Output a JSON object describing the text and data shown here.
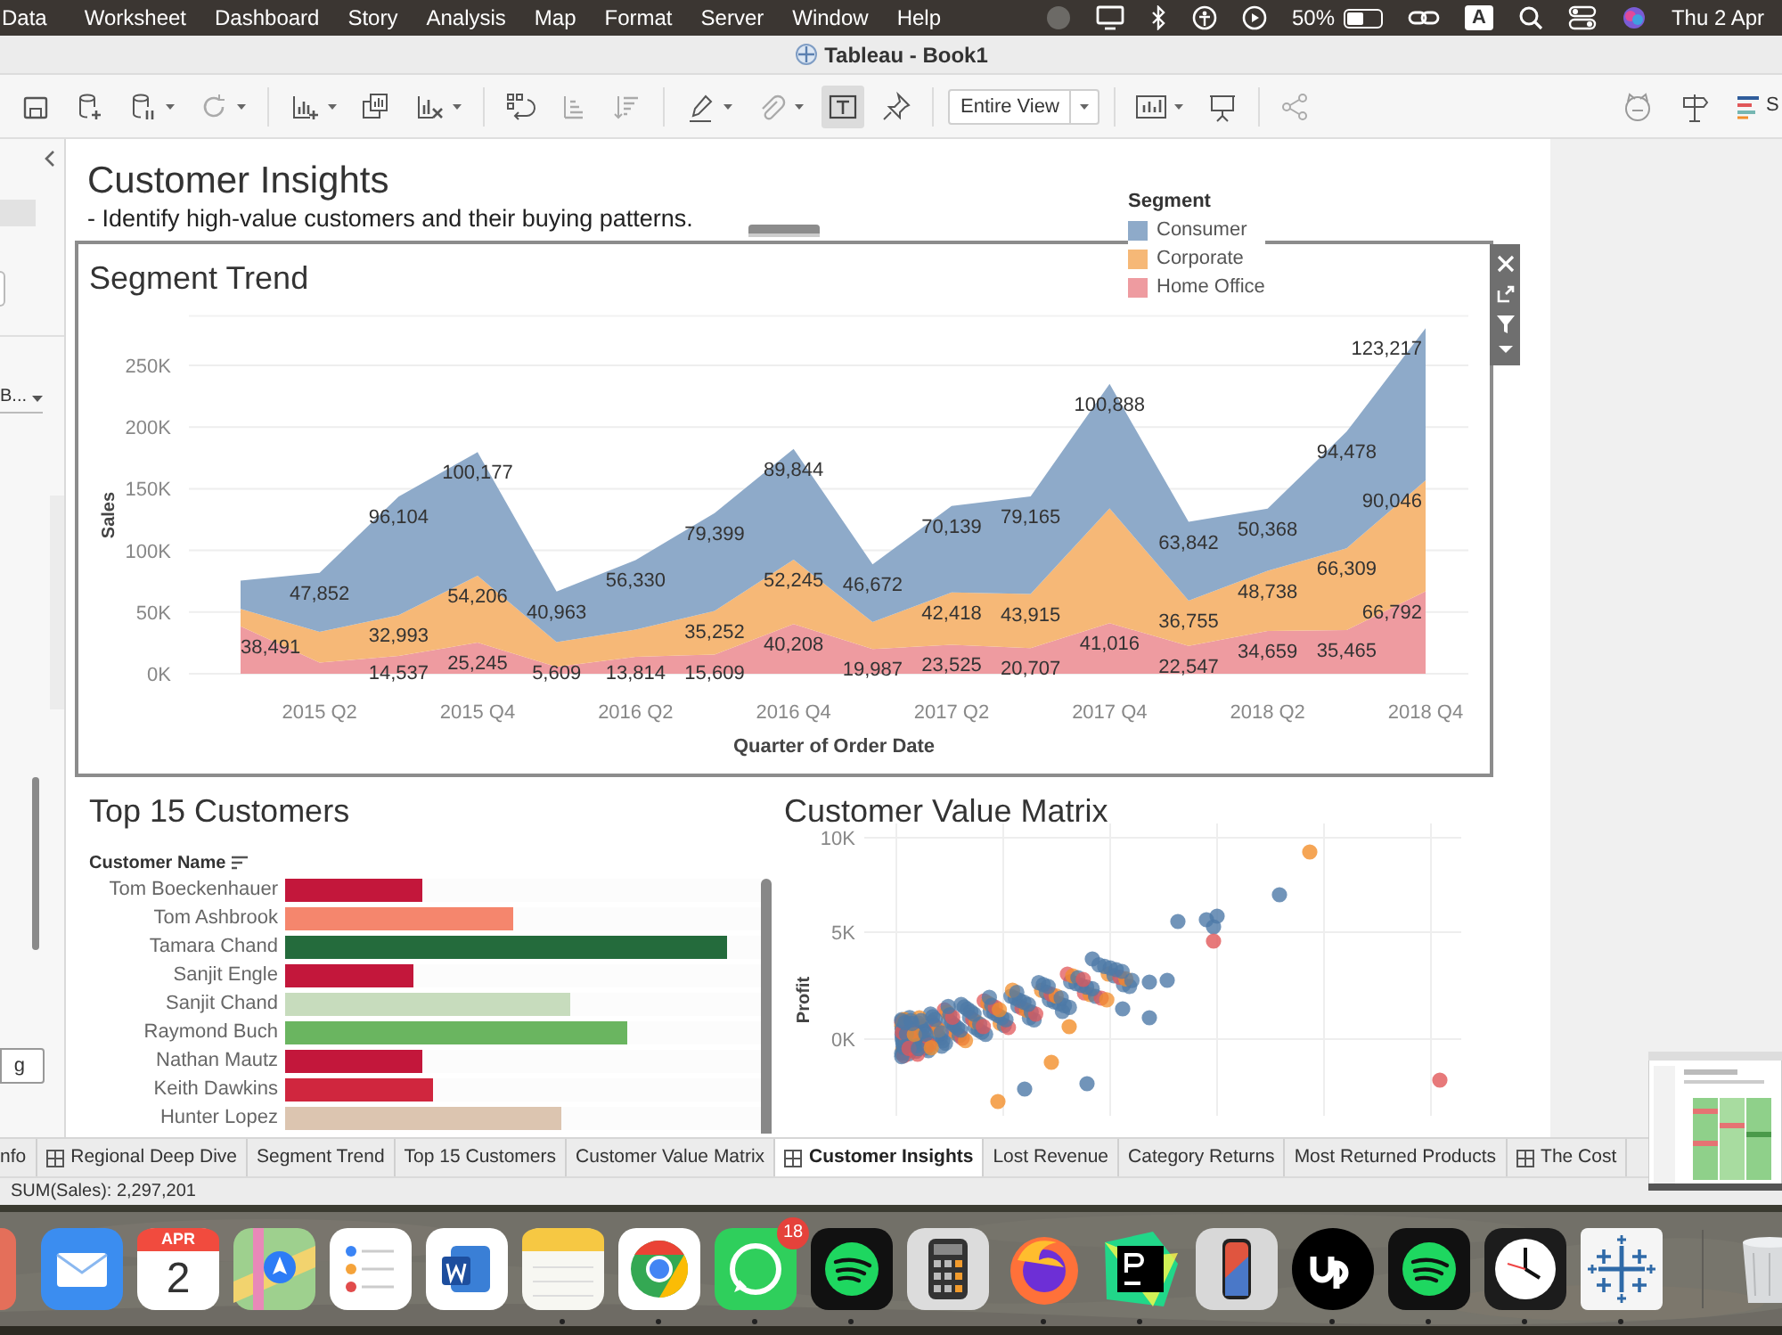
{
  "menu_bar": {
    "items": [
      "Data",
      "Worksheet",
      "Dashboard",
      "Story",
      "Analysis",
      "Map",
      "Format",
      "Server",
      "Window",
      "Help"
    ],
    "battery": "50%",
    "input_source": "A",
    "clock": "Thu 2 Apr"
  },
  "window": {
    "title": "Tableau - Book1"
  },
  "toolbar": {
    "groups": [
      [
        {
          "kind": "save",
          "caret": false,
          "on": false
        },
        {
          "kind": "add-data",
          "caret": false,
          "on": false
        },
        {
          "kind": "pause-data",
          "caret": true,
          "on": false
        },
        {
          "kind": "refresh",
          "caret": true,
          "on": false
        }
      ],
      [
        {
          "kind": "new-sheet",
          "caret": true,
          "on": false
        },
        {
          "kind": "duplicate",
          "caret": false,
          "on": false
        },
        {
          "kind": "clear",
          "caret": true,
          "on": false
        }
      ],
      [
        {
          "kind": "swap",
          "caret": false,
          "on": false
        },
        {
          "kind": "sort-asc",
          "caret": false,
          "on": false
        },
        {
          "kind": "sort-desc",
          "caret": false,
          "on": false
        }
      ],
      [
        {
          "kind": "pen",
          "caret": true,
          "on": false
        },
        {
          "kind": "clip",
          "caret": true,
          "on": false
        },
        {
          "kind": "text",
          "caret": false,
          "on": true
        },
        {
          "kind": "pin",
          "caret": false,
          "on": false
        }
      ]
    ],
    "fit": "Entire View",
    "groups_after": [
      [
        {
          "kind": "chart",
          "caret": true,
          "on": false
        },
        {
          "kind": "present",
          "caret": false,
          "on": false
        }
      ],
      [
        {
          "kind": "share",
          "caret": false,
          "on": false
        }
      ]
    ],
    "show_me": "S"
  },
  "sidebar": {
    "dropdown": "B...",
    "field": "g"
  },
  "dashboard": {
    "title": "Customer Insights",
    "subtitle": "- Identify high-value customers and their buying patterns.",
    "legend_title": "Segment",
    "segment_trend": {
      "title": "Segment Trend",
      "chart_data": {
        "type": "area",
        "stacked": true,
        "grid": true,
        "xlabel": "Quarter of Order Date",
        "ylabel": "Sales",
        "ylim": [
          0,
          290000
        ],
        "categories": [
          null,
          "2015 Q2",
          null,
          "2015 Q4",
          null,
          "2016 Q2",
          null,
          "2016 Q4",
          null,
          "2017 Q2",
          null,
          "2017 Q4",
          null,
          "2018 Q2",
          null,
          "2018 Q4"
        ],
        "yticks": [
          {
            "value": 0,
            "label": "0K"
          },
          {
            "value": 50000,
            "label": "50K"
          },
          {
            "value": 100000,
            "label": "100K"
          },
          {
            "value": 150000,
            "label": "150K"
          },
          {
            "value": 200000,
            "label": "200K"
          },
          {
            "value": 250000,
            "label": "250K"
          }
        ],
        "series": [
          {
            "name": "Consumer",
            "color": "#8eaac9",
            "values": [
              23000,
              47852,
              96104,
              100177,
              40963,
              56330,
              79399,
              89844,
              46672,
              70139,
              79165,
              100888,
              63842,
              50368,
              94478,
              123217
            ]
          },
          {
            "name": "Corporate",
            "color": "#f6b877",
            "values": [
              14000,
              25000,
              32993,
              54206,
              20000,
              22000,
              35252,
              52245,
              22000,
              42418,
              43915,
              93000,
              36755,
              48738,
              66309,
              90046
            ]
          },
          {
            "name": "Home Office",
            "color": "#ee9ba0",
            "values": [
              38491,
              9000,
              14537,
              25245,
              5609,
              13814,
              15609,
              40208,
              19987,
              23525,
              20707,
              41016,
              22547,
              34659,
              35465,
              66792
            ]
          }
        ]
      },
      "point_labels": [
        {
          "p1": "47,852",
          "p2": "96,104",
          "p3": "100,177",
          "p4": "40,963",
          "p5": "56,330",
          "p6": "79,399",
          "p7": "89,844",
          "p8": "46,672",
          "p9": "70,139",
          "p10": "79,165",
          "p11": "100,888",
          "p12": "63,842",
          "p13": "50,368",
          "p14": "94,478",
          "p15": "123,217"
        },
        {
          "p2": "32,993",
          "p3": "54,206",
          "p6": "35,252",
          "p7": "52,245",
          "p9": "42,418",
          "p10": "43,915",
          "p12": "36,755",
          "p13": "48,738",
          "p14": "66,309",
          "p15": "90,046"
        },
        {
          "p0": "38,491",
          "p2": "14,537",
          "p3": "25,245",
          "p4": "5,609",
          "p5": "13,814",
          "p6": "15,609",
          "p7": "40,208",
          "p8": "19,987",
          "p9": "23,525",
          "p10": "20,707",
          "p11": "41,016",
          "p12": "22,547",
          "p13": "34,659",
          "p14": "35,465",
          "p15": "66,792"
        }
      ]
    },
    "top_customers": {
      "title": "Top 15 Customers",
      "header": "Customer Name",
      "rows": [
        {
          "name": "Tom Boeckenhauer",
          "level": 0.29,
          "color": "#c3173b"
        },
        {
          "name": "Tom Ashbrook",
          "level": 0.48,
          "color": "#f5866d"
        },
        {
          "name": "Tamara Chand",
          "level": 0.93,
          "color": "#246b3c"
        },
        {
          "name": "Sanjit Engle",
          "level": 0.27,
          "color": "#c3173b"
        },
        {
          "name": "Sanjit Chand",
          "level": 0.6,
          "color": "#c7dcbd"
        },
        {
          "name": "Raymond Buch",
          "level": 0.72,
          "color": "#6ab560"
        },
        {
          "name": "Nathan Mautz",
          "level": 0.29,
          "color": "#c3173b"
        },
        {
          "name": "Keith Dawkins",
          "level": 0.31,
          "color": "#d0263e"
        },
        {
          "name": "Hunter Lopez",
          "level": 0.58,
          "color": "#dcc5b0"
        }
      ]
    },
    "value_matrix": {
      "title": "Customer Value Matrix",
      "ylabel": "Profit",
      "yticks": [
        "10K",
        "5K",
        "0K"
      ]
    }
  },
  "sheet_tabs": [
    {
      "label": "nfo",
      "kind": "sheet",
      "selected": false
    },
    {
      "label": "Regional Deep Dive",
      "kind": "dashboard",
      "selected": false
    },
    {
      "label": "Segment Trend",
      "kind": "sheet",
      "selected": false
    },
    {
      "label": "Top 15 Customers",
      "kind": "sheet",
      "selected": false
    },
    {
      "label": "Customer Value Matrix",
      "kind": "sheet",
      "selected": false
    },
    {
      "label": "Customer Insights",
      "kind": "dashboard",
      "selected": true
    },
    {
      "label": "Lost Revenue",
      "kind": "sheet",
      "selected": false
    },
    {
      "label": "Category Returns",
      "kind": "sheet",
      "selected": false
    },
    {
      "label": "Most Returned Products",
      "kind": "sheet",
      "selected": false
    },
    {
      "label": "The Cost",
      "kind": "dashboard",
      "selected": false
    }
  ],
  "status_bar": "SUM(Sales): 2,297,201",
  "dock": [
    {
      "kind": "mail",
      "running": false
    },
    {
      "kind": "calendar",
      "running": false,
      "month": "APR",
      "day": "2"
    },
    {
      "kind": "maps",
      "running": false
    },
    {
      "kind": "reminders",
      "running": false
    },
    {
      "kind": "word",
      "running": false
    },
    {
      "kind": "notes",
      "running": true
    },
    {
      "kind": "chrome",
      "running": true
    },
    {
      "kind": "whatsapp",
      "running": true,
      "badge": "18"
    },
    {
      "kind": "spotify",
      "running": true
    },
    {
      "kind": "calculator",
      "running": false
    },
    {
      "kind": "firefox",
      "running": true
    },
    {
      "kind": "pycharm",
      "running": true
    },
    {
      "kind": "phone",
      "running": false
    },
    {
      "kind": "upwork",
      "running": true
    },
    {
      "kind": "spotify",
      "running": true
    },
    {
      "kind": "clock",
      "running": true
    },
    {
      "kind": "tableau",
      "running": true
    },
    {
      "kind": "trash",
      "running": false
    }
  ]
}
